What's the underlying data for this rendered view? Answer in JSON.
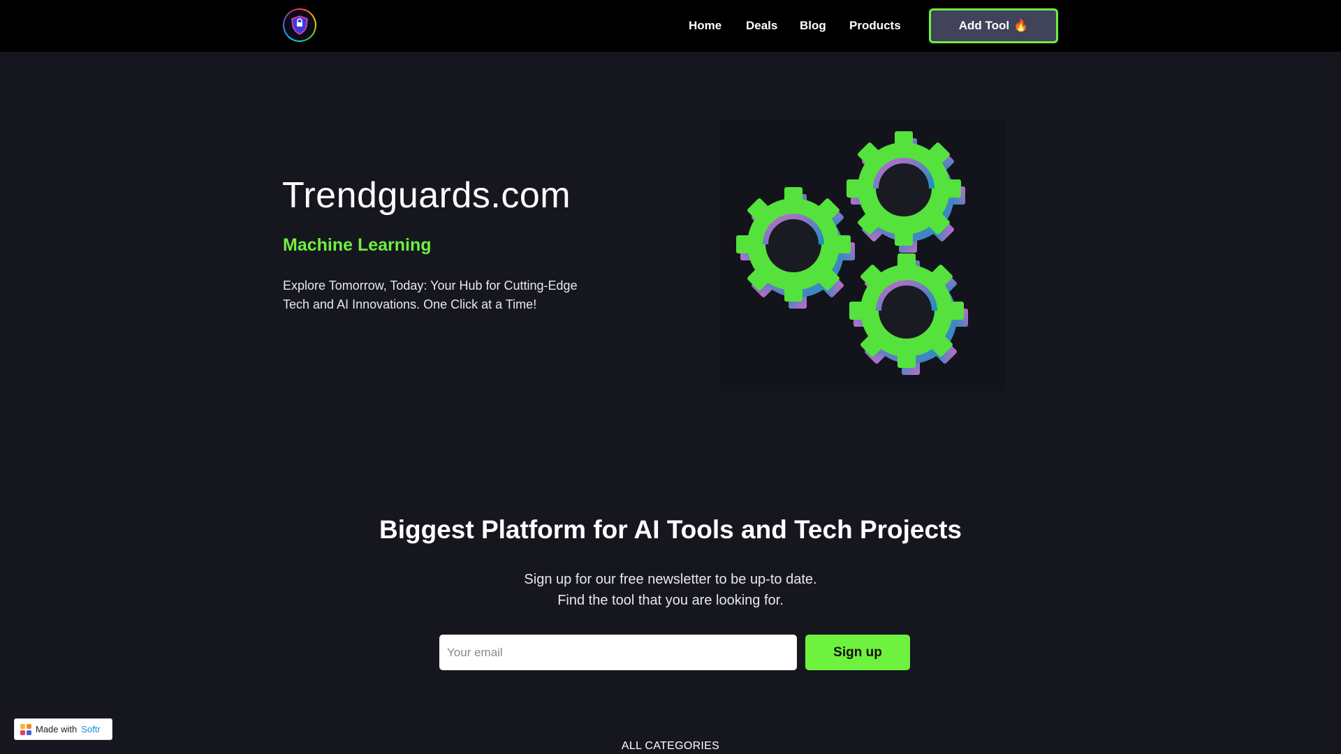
{
  "header": {
    "logo_alt": "Trendguards logo",
    "nav": [
      "Home",
      "Deals",
      "Blog",
      "Products"
    ],
    "add_tool_label": "Add Tool",
    "add_tool_icon": "🔥"
  },
  "hero": {
    "title": "Trendguards.com",
    "subtitle": "Machine Learning",
    "description": "Explore Tomorrow, Today: Your Hub for Cutting-Edge Tech and AI Innovations. One Click at a Time!"
  },
  "newsletter": {
    "title": "Biggest Platform for AI Tools and Tech Projects",
    "subtitle_line1": "Sign up for our free newsletter to be up-to date.",
    "subtitle_line2": "Find the tool that you are looking for.",
    "email_placeholder": "Your email",
    "signup_label": "Sign up"
  },
  "categories": {
    "label": "ALL CATEGORIES"
  },
  "badge": {
    "prefix": "Made with",
    "brand": "Softr"
  },
  "colors": {
    "accent": "#6ef13f",
    "background": "#16161f",
    "header": "#000000"
  }
}
